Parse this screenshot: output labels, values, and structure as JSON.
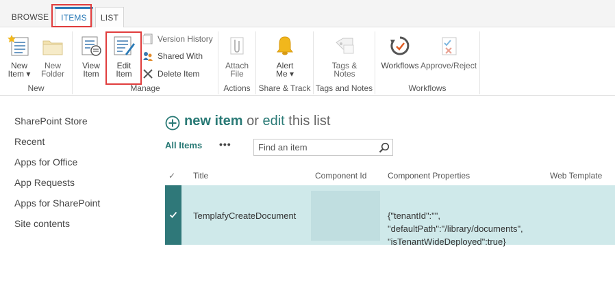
{
  "tabs": {
    "browse": "BROWSE",
    "items": "ITEMS",
    "list": "LIST"
  },
  "ribbon": {
    "new_group": {
      "title": "New",
      "new_item": "New\nItem ▾",
      "new_folder": "New\nFolder"
    },
    "manage_group": {
      "title": "Manage",
      "view_item": "View\nItem",
      "edit_item": "Edit\nItem",
      "version_history": "Version History",
      "shared_with": "Shared With",
      "delete_item": "Delete Item"
    },
    "actions_group": {
      "title": "Actions",
      "attach_file": "Attach\nFile"
    },
    "share_group": {
      "title": "Share & Track",
      "alert_me": "Alert\nMe ▾"
    },
    "tags_group": {
      "title": "Tags and Notes",
      "tags_notes": "Tags &\nNotes"
    },
    "workflows_group": {
      "title": "Workflows",
      "workflows": "Workflows",
      "approve_reject": "Approve/Reject"
    }
  },
  "left_nav": [
    "SharePoint Store",
    "Recent",
    "Apps for Office",
    "App Requests",
    "Apps for SharePoint",
    "Site contents"
  ],
  "main": {
    "new_item": "new item",
    "or": " or ",
    "edit": "edit",
    "this_list": " this list",
    "view_name": "All Items",
    "more": "•••",
    "search_placeholder": "Find an item"
  },
  "grid": {
    "headers": {
      "check": "✓",
      "title": "Title",
      "component_id": "Component Id",
      "component_properties": "Component Properties",
      "web_template": "Web Template"
    },
    "rows": [
      {
        "title": "TemplafyCreateDocument",
        "component_id": "",
        "props_line1": "{\"tenantId\":\"\",",
        "props_line2": "\"defaultPath\":\"/library/documents\",",
        "props_line3": "\"isTenantWideDeployed\":true}"
      }
    ]
  },
  "colors": {
    "accent_teal": "#2a7a76",
    "selected_row": "#cfe9ea",
    "row_marker": "#2f7879",
    "highlight_box": "#e03c3c",
    "tab_accent": "#2a7ab7"
  }
}
